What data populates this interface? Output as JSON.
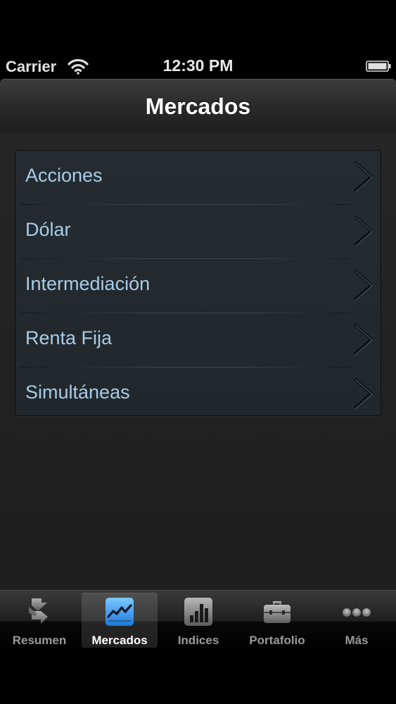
{
  "status_bar": {
    "carrier": "Carrier",
    "time": "12:30 PM",
    "wifi_icon": "wifi-icon",
    "battery_icon": "battery-icon"
  },
  "nav_bar": {
    "title": "Mercados"
  },
  "menu": {
    "items": [
      {
        "label": "Acciones",
        "icon": "chevron-right-icon"
      },
      {
        "label": "Dólar",
        "icon": "chevron-right-icon"
      },
      {
        "label": "Intermediación",
        "icon": "chevron-right-icon"
      },
      {
        "label": "Renta Fija",
        "icon": "chevron-right-icon"
      },
      {
        "label": "Simultáneas",
        "icon": "chevron-right-icon"
      }
    ]
  },
  "tab_bar": {
    "tabs": [
      {
        "label": "Resumen",
        "icon": "swap-arrows-icon",
        "selected": false
      },
      {
        "label": "Mercados",
        "icon": "line-chart-icon",
        "selected": true
      },
      {
        "label": "Indices",
        "icon": "bar-chart-icon",
        "selected": false
      },
      {
        "label": "Portafolio",
        "icon": "briefcase-icon",
        "selected": false
      },
      {
        "label": "Más",
        "icon": "more-dots-icon",
        "selected": false
      }
    ]
  },
  "colors": {
    "accent_text": "#a6cde8",
    "selected_tab_icon": "#3aa0f0"
  }
}
